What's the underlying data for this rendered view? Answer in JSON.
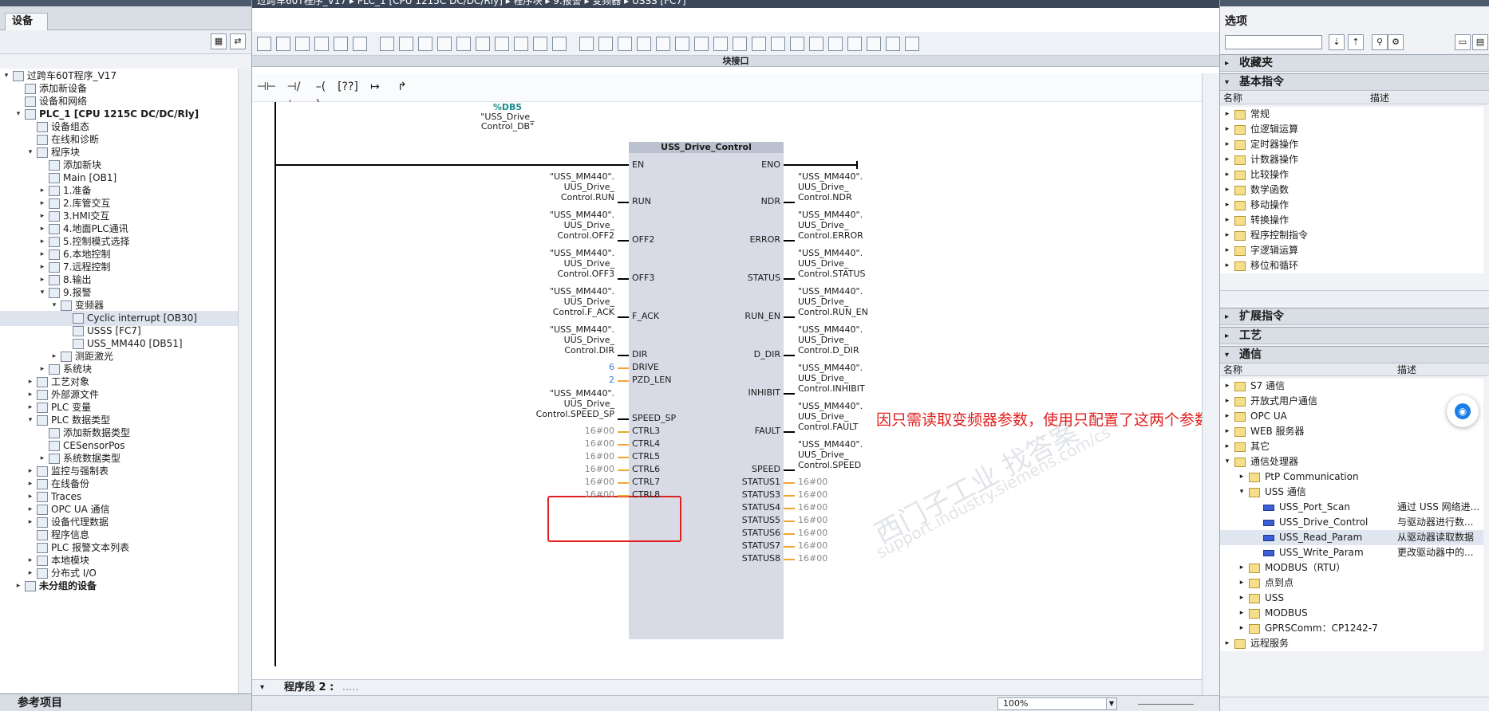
{
  "window": {
    "editor_title": "过跨车60T程序_V17 ▸ PLC_1 [CPU 1215C DC/DC/Rly] ▸ 程序块 ▸ 9.报警 ▸ 变频器 ▸ USSS [FC7]"
  },
  "left_panel": {
    "header": "设备",
    "tab": "设备",
    "tree": [
      {
        "label": "过跨车60T程序_V17",
        "level": 0,
        "arrow": "▾"
      },
      {
        "label": "添加新设备",
        "level": 1,
        "arrow": ""
      },
      {
        "label": "设备和网络",
        "level": 1,
        "arrow": ""
      },
      {
        "label": "PLC_1 [CPU 1215C DC/DC/Rly]",
        "level": 1,
        "arrow": "▾",
        "bold": true
      },
      {
        "label": "设备组态",
        "level": 2,
        "arrow": ""
      },
      {
        "label": "在线和诊断",
        "level": 2,
        "arrow": ""
      },
      {
        "label": "程序块",
        "level": 2,
        "arrow": "▾"
      },
      {
        "label": "添加新块",
        "level": 3,
        "arrow": ""
      },
      {
        "label": "Main [OB1]",
        "level": 3,
        "arrow": ""
      },
      {
        "label": "1.准备",
        "level": 3,
        "arrow": "▸"
      },
      {
        "label": "2.库管交互",
        "level": 3,
        "arrow": "▸"
      },
      {
        "label": "3.HMI交互",
        "level": 3,
        "arrow": "▸"
      },
      {
        "label": "4.地面PLC通讯",
        "level": 3,
        "arrow": "▸"
      },
      {
        "label": "5.控制模式选择",
        "level": 3,
        "arrow": "▸"
      },
      {
        "label": "6.本地控制",
        "level": 3,
        "arrow": "▸"
      },
      {
        "label": "7.远程控制",
        "level": 3,
        "arrow": "▸"
      },
      {
        "label": "8.输出",
        "level": 3,
        "arrow": "▸"
      },
      {
        "label": "9.报警",
        "level": 3,
        "arrow": "▾"
      },
      {
        "label": "变频器",
        "level": 4,
        "arrow": "▾"
      },
      {
        "label": "Cyclic interrupt [OB30]",
        "level": 5,
        "arrow": "",
        "hl": true
      },
      {
        "label": "USSS [FC7]",
        "level": 5,
        "arrow": ""
      },
      {
        "label": "USS_MM440 [DB51]",
        "level": 5,
        "arrow": ""
      },
      {
        "label": "测距激光",
        "level": 4,
        "arrow": "▸"
      },
      {
        "label": "系统块",
        "level": 3,
        "arrow": "▸"
      },
      {
        "label": "工艺对象",
        "level": 2,
        "arrow": "▸"
      },
      {
        "label": "外部源文件",
        "level": 2,
        "arrow": "▸"
      },
      {
        "label": "PLC 变量",
        "level": 2,
        "arrow": "▸"
      },
      {
        "label": "PLC 数据类型",
        "level": 2,
        "arrow": "▾"
      },
      {
        "label": "添加新数据类型",
        "level": 3,
        "arrow": ""
      },
      {
        "label": "CESensorPos",
        "level": 3,
        "arrow": ""
      },
      {
        "label": "系统数据类型",
        "level": 3,
        "arrow": "▸"
      },
      {
        "label": "监控与强制表",
        "level": 2,
        "arrow": "▸"
      },
      {
        "label": "在线备份",
        "level": 2,
        "arrow": "▸"
      },
      {
        "label": "Traces",
        "level": 2,
        "arrow": "▸"
      },
      {
        "label": "OPC UA 通信",
        "level": 2,
        "arrow": "▸"
      },
      {
        "label": "设备代理数据",
        "level": 2,
        "arrow": "▸"
      },
      {
        "label": "程序信息",
        "level": 2,
        "arrow": ""
      },
      {
        "label": "PLC 报警文本列表",
        "level": 2,
        "arrow": ""
      },
      {
        "label": "本地模块",
        "level": 2,
        "arrow": "▸"
      },
      {
        "label": "分布式 I/O",
        "level": 2,
        "arrow": "▸"
      },
      {
        "label": "未分组的设备",
        "level": 1,
        "arrow": "▸",
        "bold": true
      }
    ],
    "footer": "参考项目"
  },
  "editor": {
    "interface_bar": "块接口",
    "network2": "程序段 2 :",
    "network2_dots": ".....",
    "zoom": "100%",
    "ladder_buttons": [
      "⊣⊢",
      "⊣/⊢",
      "–( )–",
      "[??]",
      "↦",
      "↱"
    ],
    "fb": {
      "db_address": "%DB5",
      "db_name_line1": "\"USS_Drive_",
      "db_name_line2": "Control_DB\"",
      "name": "USS_Drive_Control",
      "en": "EN",
      "eno": "ENO",
      "inputs": [
        {
          "pin": "RUN",
          "param": "\"USS_MM440\".\nUUS_Drive_\nControl.RUN"
        },
        {
          "pin": "OFF2",
          "param": "\"USS_MM440\".\nUUS_Drive_\nControl.OFF2"
        },
        {
          "pin": "OFF3",
          "param": "\"USS_MM440\".\nUUS_Drive_\nControl.OFF3"
        },
        {
          "pin": "F_ACK",
          "param": "\"USS_MM440\".\nUUS_Drive_\nControl.F_ACK"
        },
        {
          "pin": "DIR",
          "param": "\"USS_MM440\".\nUUS_Drive_\nControl.DIR"
        },
        {
          "pin": "DRIVE",
          "param": "6"
        },
        {
          "pin": "PZD_LEN",
          "param": "2"
        },
        {
          "pin": "SPEED_SP",
          "param": "\"USS_MM440\".\nUUS_Drive_\nControl.SPEED_SP"
        },
        {
          "pin": "CTRL3",
          "param": "16#00"
        },
        {
          "pin": "CTRL4",
          "param": "16#00"
        },
        {
          "pin": "CTRL5",
          "param": "16#00"
        },
        {
          "pin": "CTRL6",
          "param": "16#00"
        },
        {
          "pin": "CTRL7",
          "param": "16#00"
        },
        {
          "pin": "CTRL8",
          "param": "16#00"
        }
      ],
      "outputs": [
        {
          "pin": "NDR",
          "param": "\"USS_MM440\".\nUUS_Drive_\nControl.NDR"
        },
        {
          "pin": "ERROR",
          "param": "\"USS_MM440\".\nUUS_Drive_\nControl.ERROR"
        },
        {
          "pin": "STATUS",
          "param": "\"USS_MM440\".\nUUS_Drive_\nControl.STATUS"
        },
        {
          "pin": "RUN_EN",
          "param": "\"USS_MM440\".\nUUS_Drive_\nControl.RUN_EN"
        },
        {
          "pin": "D_DIR",
          "param": "\"USS_MM440\".\nUUS_Drive_\nControl.D_DIR"
        },
        {
          "pin": "INHIBIT",
          "param": "\"USS_MM440\".\nUUS_Drive_\nControl.INHIBIT"
        },
        {
          "pin": "FAULT",
          "param": "\"USS_MM440\".\nUUS_Drive_\nControl.FAULT"
        },
        {
          "pin": "SPEED",
          "param": "\"USS_MM440\".\nUUS_Drive_\nControl.SPEED"
        },
        {
          "pin": "STATUS1",
          "param": "16#00"
        },
        {
          "pin": "STATUS3",
          "param": "16#00"
        },
        {
          "pin": "STATUS4",
          "param": "16#00"
        },
        {
          "pin": "STATUS5",
          "param": "16#00"
        },
        {
          "pin": "STATUS6",
          "param": "16#00"
        },
        {
          "pin": "STATUS7",
          "param": "16#00"
        },
        {
          "pin": "STATUS8",
          "param": "16#00"
        }
      ]
    },
    "annotation": "因只需读取变频器参数，使用只配置了这两个参数，其余的都是没写入",
    "watermark_1": "西门子工业 找答案",
    "watermark_2": "support.industry.siemens.com/cs"
  },
  "right_panel": {
    "title": "选项",
    "sections": {
      "favorites": "收藏夹",
      "basic": "基本指令",
      "extended": "扩展指令",
      "technology": "工艺",
      "communication": "通信"
    },
    "col_name": "名称",
    "col_desc": "描述",
    "basic_items": [
      "常规",
      "位逻辑运算",
      "定时器操作",
      "计数器操作",
      "比较操作",
      "数学函数",
      "移动操作",
      "转换操作",
      "程序控制指令",
      "字逻辑运算",
      "移位和循环"
    ],
    "comm_items": [
      {
        "label": "S7 通信",
        "level": 0,
        "arrow": "▸",
        "desc": ""
      },
      {
        "label": "开放式用户通信",
        "level": 0,
        "arrow": "▸",
        "desc": ""
      },
      {
        "label": "OPC UA",
        "level": 0,
        "arrow": "▸",
        "desc": ""
      },
      {
        "label": "WEB 服务器",
        "level": 0,
        "arrow": "▸",
        "desc": ""
      },
      {
        "label": "其它",
        "level": 0,
        "arrow": "▸",
        "desc": ""
      },
      {
        "label": "通信处理器",
        "level": 0,
        "arrow": "▾",
        "desc": ""
      },
      {
        "label": "PtP Communication",
        "level": 1,
        "arrow": "▸",
        "desc": ""
      },
      {
        "label": "USS 通信",
        "level": 1,
        "arrow": "▾",
        "desc": ""
      },
      {
        "label": "USS_Port_Scan",
        "level": 2,
        "arrow": "",
        "desc": "通过 USS 网络进...",
        "blue": true
      },
      {
        "label": "USS_Drive_Control",
        "level": 2,
        "arrow": "",
        "desc": "与驱动器进行数...",
        "blue": true
      },
      {
        "label": "USS_Read_Param",
        "level": 2,
        "arrow": "",
        "desc": "从驱动器读取数据",
        "blue": true,
        "hl": true
      },
      {
        "label": "USS_Write_Param",
        "level": 2,
        "arrow": "",
        "desc": "更改驱动器中的...",
        "blue": true
      },
      {
        "label": "MODBUS（RTU）",
        "level": 1,
        "arrow": "▸",
        "desc": ""
      },
      {
        "label": "点到点",
        "level": 1,
        "arrow": "▸",
        "desc": ""
      },
      {
        "label": "USS",
        "level": 1,
        "arrow": "▸",
        "desc": ""
      },
      {
        "label": "MODBUS",
        "level": 1,
        "arrow": "▸",
        "desc": ""
      },
      {
        "label": "GPRSComm：CP1242-7",
        "level": 1,
        "arrow": "▸",
        "desc": ""
      },
      {
        "label": "远程服务",
        "level": 0,
        "arrow": "▸",
        "desc": ""
      }
    ]
  }
}
